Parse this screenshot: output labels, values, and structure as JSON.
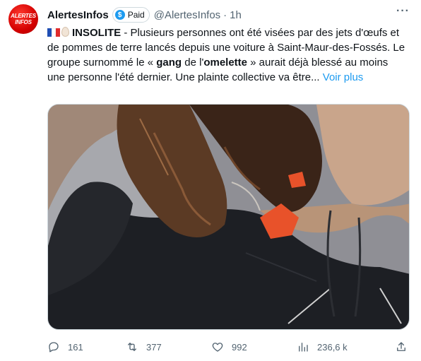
{
  "tweet": {
    "avatar_line1": "ALERTES",
    "avatar_line2": "INFOS",
    "author": "AlertesInfos",
    "badge": "Paid",
    "handle": "@AlertesInfos",
    "separator": "·",
    "time": "1h",
    "more": "···",
    "text": {
      "tag": "INSOLITE",
      "part1": " - Plusieurs personnes ont été visées par des jets d'œufs et de pommes de terre lancés depuis une voiture à Saint-Maur-des-Fossés. Le groupe surnommé le « ",
      "bold1": "gang",
      "part2": " de l'",
      "bold2": "omelette",
      "part3": " » aurait déjà blessé au moins une personne l'été dernier. Une plainte collective va être... ",
      "see_more": "Voir plus"
    },
    "media_alt": "Image"
  },
  "actions": {
    "replies": "161",
    "retweets": "377",
    "likes": "992",
    "views": "236,6 k"
  },
  "colors": {
    "accent": "#1d9bf0",
    "secondary_text": "#536471",
    "avatar_red": "#d40000"
  },
  "icons": [
    "reply-icon",
    "retweet-icon",
    "like-icon",
    "views-icon",
    "share-icon",
    "flag-france-icon",
    "egg-icon",
    "dollar-icon",
    "more-icon"
  ]
}
